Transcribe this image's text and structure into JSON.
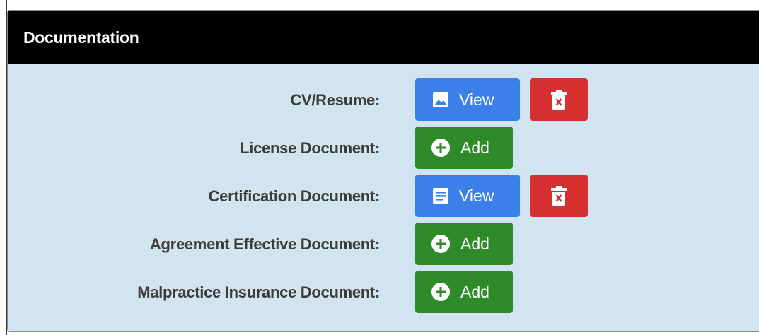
{
  "panel": {
    "title": "Documentation"
  },
  "documents": [
    {
      "label": "CV/Resume:",
      "action_label": "View",
      "action_icon": "image-icon",
      "has_delete": true
    },
    {
      "label": "License Document:",
      "action_label": "Add",
      "action_icon": "plus-circle-icon",
      "has_delete": false
    },
    {
      "label": "Certification Document:",
      "action_label": "View",
      "action_icon": "document-icon",
      "has_delete": true
    },
    {
      "label": "Agreement Effective Document:",
      "action_label": "Add",
      "action_icon": "plus-circle-icon",
      "has_delete": false
    },
    {
      "label": "Malpractice Insurance Document:",
      "action_label": "Add",
      "action_icon": "plus-circle-icon",
      "has_delete": false
    }
  ],
  "colors": {
    "header_bg": "#000000",
    "panel_bg": "#d3e4f1",
    "view_button": "#3a80e8",
    "add_button": "#2f8a2a",
    "delete_button": "#d63030"
  }
}
